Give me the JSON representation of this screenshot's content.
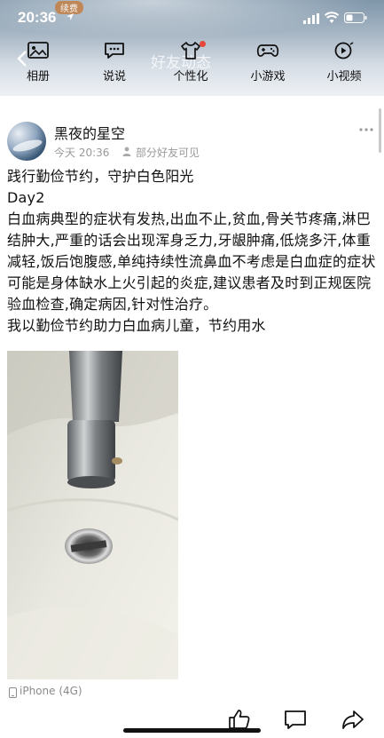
{
  "status_bar": {
    "time": "20:36",
    "tag": "续费"
  },
  "feed_header": {
    "title": "好友动态",
    "menu": [
      {
        "label": "相册",
        "icon": "photo-album-icon"
      },
      {
        "label": "说说",
        "icon": "chat-bubble-icon"
      },
      {
        "label": "个性化",
        "icon": "tshirt-icon"
      },
      {
        "label": "小游戏",
        "icon": "gamepad-icon"
      },
      {
        "label": "小视频",
        "icon": "video-icon"
      }
    ]
  },
  "post": {
    "username": "黑夜的星空",
    "time": "今天 20:36",
    "visibility": "部分好友可见",
    "lines": [
      "践行勤俭节约，守护白色阳光",
      "Day2",
      "白血病典型的症状有发热,出血不止,贫血,骨关节疼痛,淋巴结肿大,严重的话会出现浑身乏力,牙龈肿痛,低烧多汗,体重减轻,饭后饱腹感,单纯持续性流鼻血不考虑是白血症的症状可能是身体缺水上火引起的炎症,建议患者及时到正规医院验血检查,确定病因,针对性治疗。",
      "我以勤俭节约助力白血病儿童，节约用水"
    ],
    "photo_alt": "水龙头与洗手盆",
    "device": "iPhone (4G)"
  },
  "colors": {
    "notification_dot": "#e5473c",
    "muted_text": "#9a9a9a"
  }
}
